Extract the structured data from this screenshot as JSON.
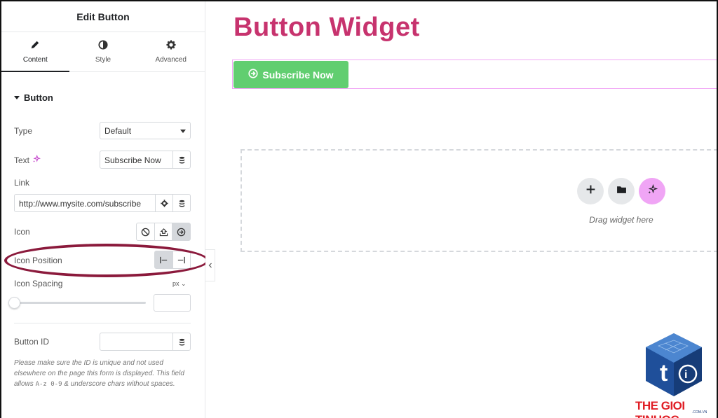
{
  "panel": {
    "title": "Edit Button",
    "tabs": [
      {
        "label": "Content",
        "icon": "pencil-icon",
        "active": true
      },
      {
        "label": "Style",
        "icon": "half-circle-icon",
        "active": false
      },
      {
        "label": "Advanced",
        "icon": "gear-icon",
        "active": false
      }
    ],
    "section_title": "Button",
    "type": {
      "label": "Type",
      "value": "Default"
    },
    "text": {
      "label": "Text",
      "value": "Subscribe Now"
    },
    "link": {
      "label": "Link",
      "value": "http://www.mysite.com/subscribe"
    },
    "icon": {
      "label": "Icon",
      "options": [
        "none-icon",
        "upload-icon",
        "circle-arrow-right-icon"
      ],
      "selected": "circle-arrow-right-icon"
    },
    "icon_position": {
      "label": "Icon Position",
      "options": [
        "before-icon",
        "after-icon"
      ],
      "selected": "before-icon"
    },
    "icon_spacing": {
      "label": "Icon Spacing",
      "unit": "px",
      "value": ""
    },
    "button_id": {
      "label": "Button ID",
      "value": ""
    },
    "help_before": "Please make sure the ID is unique and not used elsewhere on the page this form is displayed. This field allows ",
    "help_code": "A-z 0-9",
    "help_after": " & underscore chars without spaces."
  },
  "canvas": {
    "title": "Button Widget",
    "button_label": "Subscribe Now",
    "drop_zone_text": "Drag widget here"
  },
  "watermark": {
    "name": "THE GIOI TINHOC",
    "sub": ".COM.VN"
  },
  "colors": {
    "title": "#c7336e",
    "button": "#61ce70",
    "highlight": "#8b1a3c",
    "ai_accent": "#f0a5f5"
  }
}
